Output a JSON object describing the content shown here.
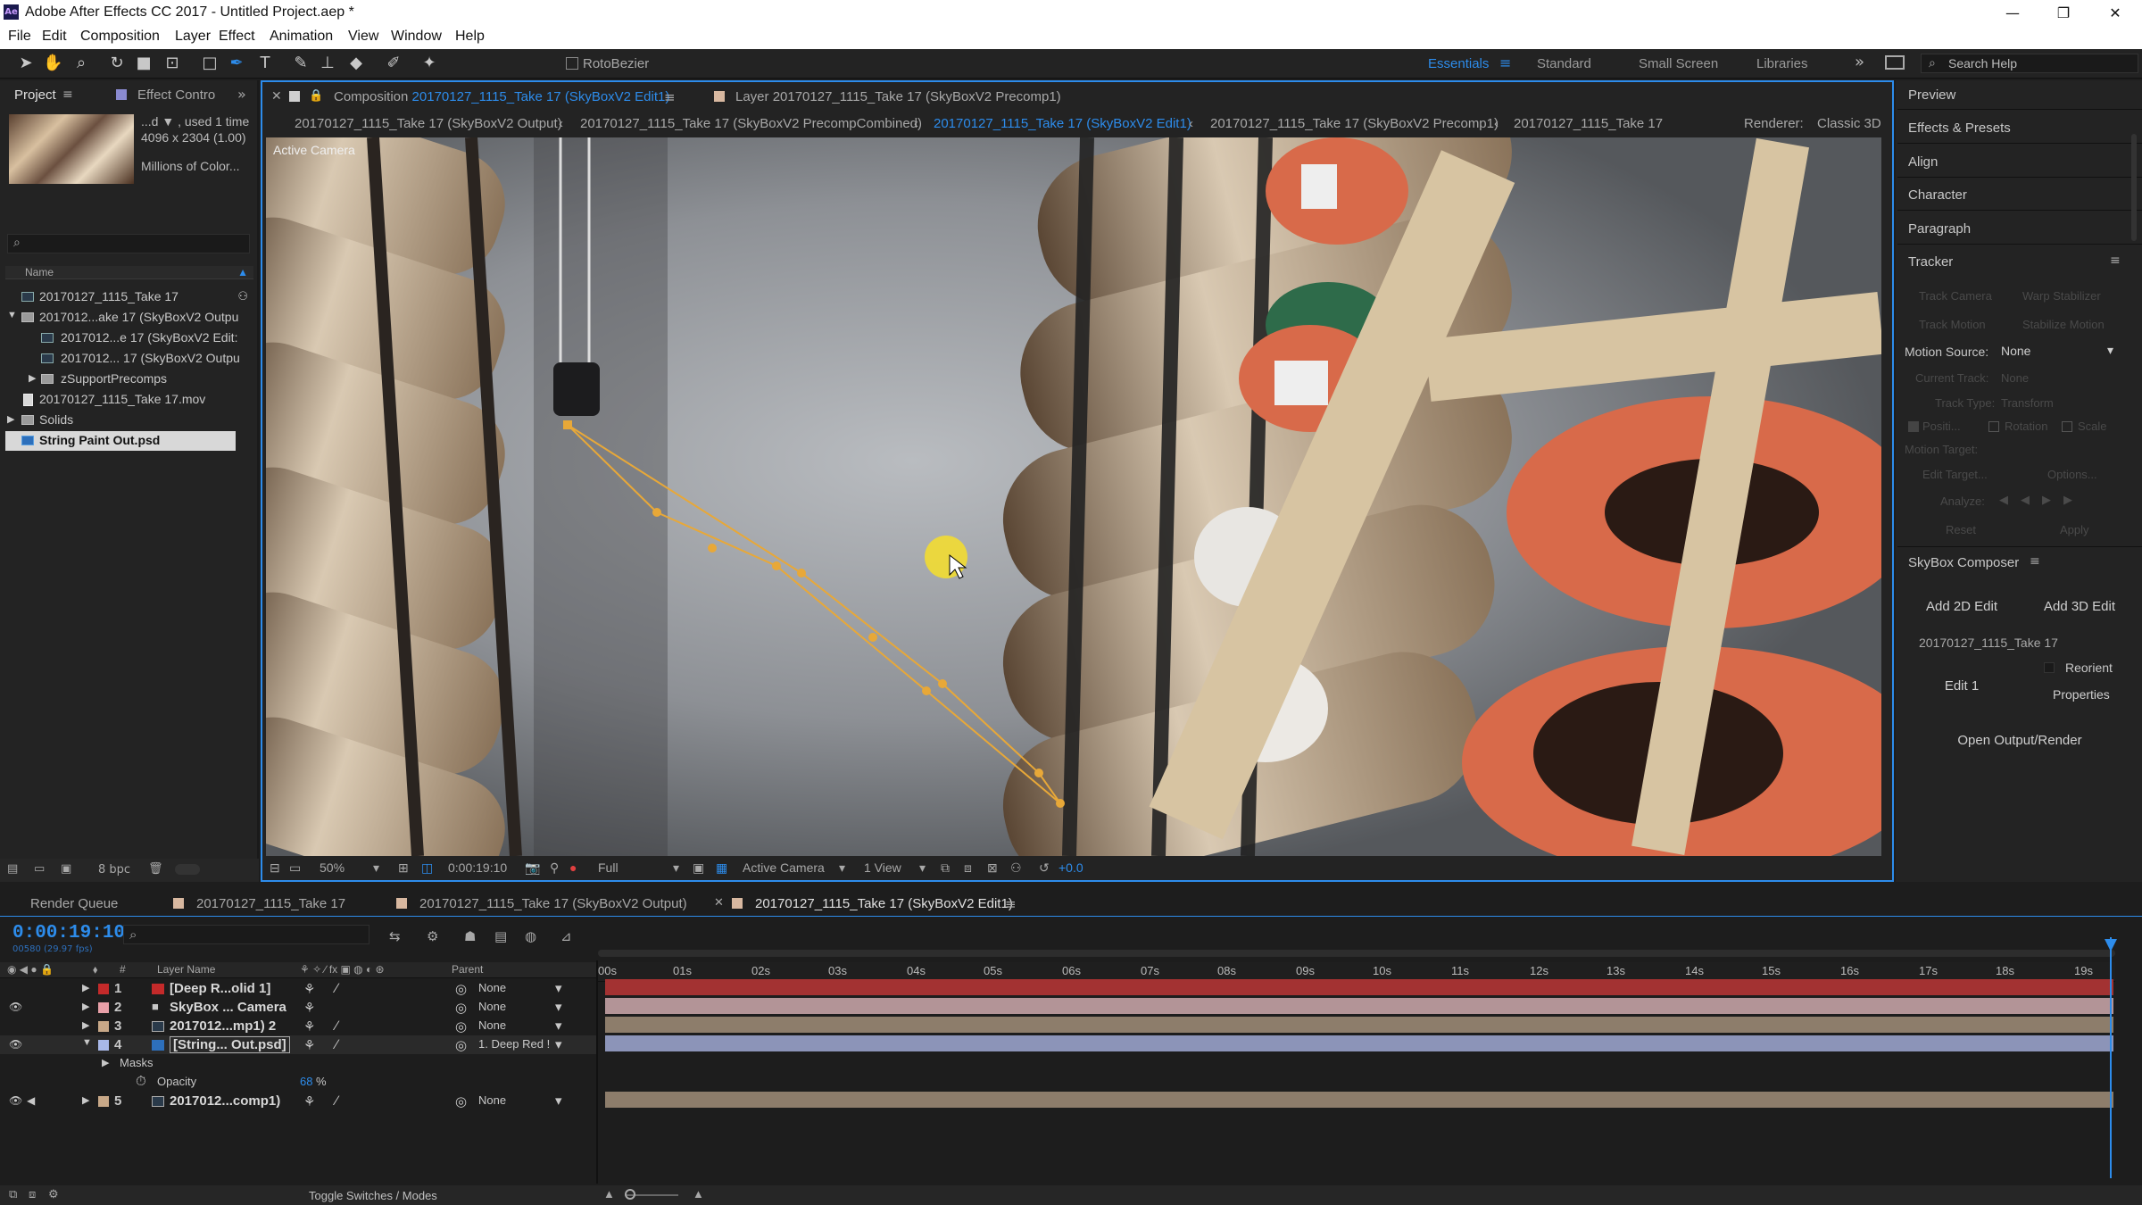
{
  "window": {
    "title": "Adobe After Effects CC 2017 - Untitled Project.aep *",
    "logo": "Ae"
  },
  "menu": [
    "File",
    "Edit",
    "Composition",
    "Layer",
    "Effect",
    "Animation",
    "View",
    "Window",
    "Help"
  ],
  "toolbar": {
    "rotobezier": "RotoBezier",
    "search_help": "Search Help"
  },
  "workspaces": [
    "Essentials",
    "Standard",
    "Small Screen",
    "Libraries"
  ],
  "project": {
    "tab_project": "Project",
    "tab_effect": "Effect Contro",
    "info_line1": "...d ▼ , used 1 time",
    "info_line2": "4096 x 2304 (1.00)",
    "info_line3": "Millions of Color...",
    "col_name": "Name",
    "items": [
      "20170127_1115_Take 17",
      "2017012...ake 17 (SkyBoxV2 Outpu",
      "2017012...e 17 (SkyBoxV2 Edit:",
      "2017012... 17 (SkyBoxV2 Outpu",
      "zSupportPrecomps",
      "20170127_1115_Take 17.mov",
      "Solids",
      "String Paint Out.psd"
    ],
    "bpc": "8 bpc"
  },
  "comp": {
    "tab_prefix": "Composition",
    "tab_name": "20170127_1115_Take 17 (SkyBoxV2 Edit1)",
    "layer_tab": "Layer 20170127_1115_Take 17 (SkyBoxV2 Precomp1)",
    "crumbs": [
      "20170127_1115_Take 17 (SkyBoxV2 Output)",
      "20170127_1115_Take 17 (SkyBoxV2 PrecompCombined)",
      "20170127_1115_Take 17 (SkyBoxV2 Edit1)",
      "20170127_1115_Take 17 (SkyBoxV2 Precomp1)",
      "20170127_1115_Take 17"
    ],
    "renderer_label": "Renderer:",
    "renderer": "Classic 3D",
    "active_camera": "Active Camera",
    "zoom": "50%",
    "time": "0:00:19:10",
    "resolution": "Full",
    "view_camera": "Active Camera",
    "views": "1 View",
    "exposure": "+0.0"
  },
  "right": {
    "sections": [
      "Preview",
      "Effects & Presets",
      "Align",
      "Character",
      "Paragraph",
      "Tracker"
    ],
    "track_camera": "Track Camera",
    "warp_stabilizer": "Warp Stabilizer",
    "track_motion": "Track Motion",
    "stabilize_motion": "Stabilize Motion",
    "motion_source_label": "Motion Source:",
    "motion_source": "None",
    "current_track_label": "Current Track:",
    "current_track": "None",
    "track_type_label": "Track Type:",
    "track_type": "Transform",
    "position": "Positi...",
    "rotation": "Rotation",
    "scale": "Scale",
    "motion_target": "Motion Target:",
    "edit_target": "Edit Target...",
    "options": "Options...",
    "analyze": "Analyze:",
    "reset": "Reset",
    "apply": "Apply",
    "skybox_title": "SkyBox Composer",
    "add2d": "Add 2D Edit",
    "add3d": "Add 3D Edit",
    "take": "20170127_1115_Take 17",
    "edit1": "Edit 1",
    "reorient": "Reorient",
    "properties": "Properties",
    "open_output": "Open Output/Render"
  },
  "timeline": {
    "tabs": [
      "Render Queue",
      "20170127_1115_Take 17",
      "20170127_1115_Take 17 (SkyBoxV2 Output)",
      "20170127_1115_Take 17 (SkyBoxV2 Edit1)"
    ],
    "timecode": "0:00:19:10",
    "fps": "00580 (29.97 fps)",
    "col_hash": "#",
    "col_layer": "Layer Name",
    "col_parent": "Parent",
    "layers": [
      {
        "num": "1",
        "name": "[Deep R...olid 1]",
        "parent": "None",
        "color": "#c42a2a"
      },
      {
        "num": "2",
        "name": "SkyBox ... Camera",
        "parent": "None",
        "color": "#e8a0a8"
      },
      {
        "num": "3",
        "name": "2017012...mp1) 2",
        "parent": "None",
        "color": "#c8a888"
      },
      {
        "num": "4",
        "name": "[String... Out.psd]",
        "parent": "1. Deep Red !",
        "color": "#a8b8e8"
      },
      {
        "num": "5",
        "name": "2017012...comp1)",
        "parent": "None",
        "color": "#c8a888"
      }
    ],
    "masks": "Masks",
    "opacity": "Opacity",
    "opacity_value": "68",
    "pct": "%",
    "ruler": [
      "00s",
      "01s",
      "02s",
      "03s",
      "04s",
      "05s",
      "06s",
      "07s",
      "08s",
      "09s",
      "10s",
      "11s",
      "12s",
      "13s",
      "14s",
      "15s",
      "16s",
      "17s",
      "18s",
      "19s"
    ],
    "toggle": "Toggle Switches / Modes"
  }
}
